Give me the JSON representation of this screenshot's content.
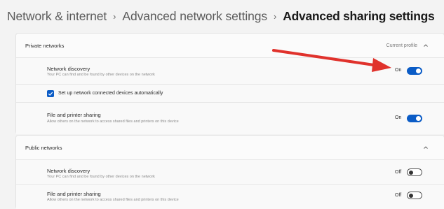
{
  "breadcrumb": {
    "items": [
      "Network & internet",
      "Advanced network settings"
    ],
    "separator": "›",
    "current": "Advanced sharing settings"
  },
  "private": {
    "title": "Private networks",
    "header_status": "Current profile",
    "network_discovery": {
      "title": "Network discovery",
      "desc": "Your PC can find and be found by other devices on the network",
      "state": "On",
      "enabled": true,
      "auto_setup_label": "Set up network connected devices automatically",
      "auto_setup_checked": true
    },
    "file_sharing": {
      "title": "File and printer sharing",
      "desc": "Allow others on the network to access shared files and printers on this device",
      "state": "On",
      "enabled": true
    }
  },
  "public": {
    "title": "Public networks",
    "network_discovery": {
      "title": "Network discovery",
      "desc": "Your PC can find and be found by other devices on the network",
      "state": "Off",
      "enabled": false
    },
    "file_sharing": {
      "title": "File and printer sharing",
      "desc": "Allow others on the network to access shared files and printers on this device",
      "state": "Off",
      "enabled": false
    }
  },
  "colors": {
    "accent": "#0b5cc6",
    "annotation_arrow": "#e0322c"
  },
  "icons": {
    "collapse": "chevron-up-icon",
    "checkbox": "checkmark-icon",
    "annotation": "red-arrow-annotation"
  }
}
